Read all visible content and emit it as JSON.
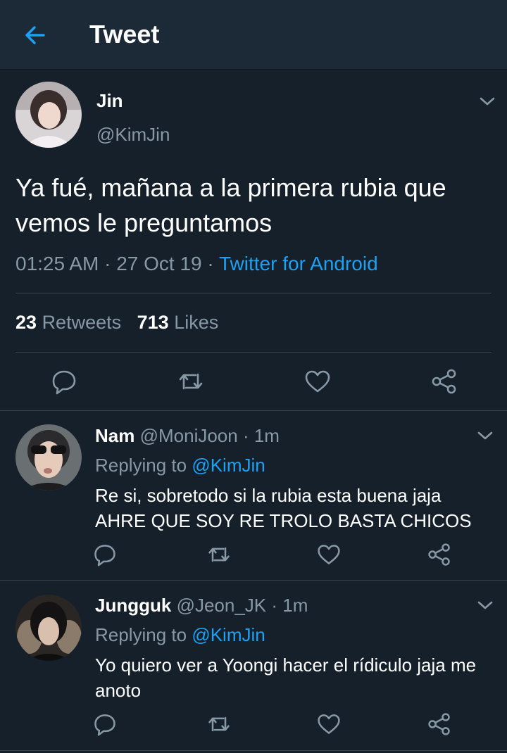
{
  "header": {
    "title": "Tweet"
  },
  "tweet": {
    "name": "Jin",
    "handle": "@KimJin",
    "text": "Ya fué, mañana a la primera rubia que vemos le preguntamos",
    "time": "01:25 AM",
    "sep1": " · ",
    "date": "27 Oct 19",
    "sep2": " · ",
    "source": "Twitter for Android",
    "retweets": "23",
    "retweets_label": "Retweets",
    "likes": "713",
    "likes_label": "Likes"
  },
  "replies": [
    {
      "name": "Nam",
      "handle": "@MoniJoon",
      "sep": " · ",
      "time": "1m",
      "replying_label": "Replying to",
      "replying_handle": "@KimJin",
      "text": "Re si, sobretodo si la rubia esta buena jaja AHRE QUE SOY RE TROLO BASTA CHICOS"
    },
    {
      "name": "Jungguk",
      "handle": "@Jeon_JK",
      "sep": " · ",
      "time": "1m",
      "replying_label": "Replying to",
      "replying_handle": "@KimJin",
      "text": "Yo quiero ver a Yoongi hacer el rídiculo jaja me anoto"
    }
  ],
  "colors": {
    "background": "#15202b",
    "topbar": "#1c2a38",
    "accent": "#1da1f2",
    "muted": "#8899a6",
    "divider": "#38444d"
  },
  "icons": [
    "back-arrow-icon",
    "chevron-down-icon",
    "reply-icon",
    "retweet-icon",
    "like-icon",
    "share-icon"
  ]
}
